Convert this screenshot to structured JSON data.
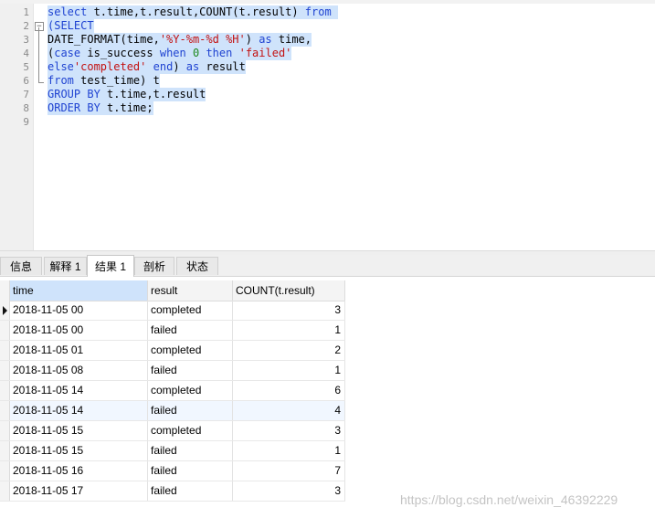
{
  "editor": {
    "line_numbers": [
      "1",
      "2",
      "3",
      "4",
      "5",
      "6",
      "7",
      "8",
      "9"
    ],
    "lines": [
      [
        {
          "t": "select",
          "c": "kw"
        },
        {
          "t": " t.time,t.result,COUNT(t.result) ",
          "c": ""
        },
        {
          "t": "from",
          "c": "kw"
        },
        {
          "t": " ",
          "c": ""
        }
      ],
      [
        {
          "t": "(SELECT",
          "c": "kw"
        }
      ],
      [
        {
          "t": "DATE_FORMAT(time,",
          "c": ""
        },
        {
          "t": "'%Y-%m-%d %H'",
          "c": "str"
        },
        {
          "t": ") ",
          "c": ""
        },
        {
          "t": "as",
          "c": "kw"
        },
        {
          "t": " time,",
          "c": ""
        }
      ],
      [
        {
          "t": "(",
          "c": ""
        },
        {
          "t": "case",
          "c": "kw"
        },
        {
          "t": " is_success ",
          "c": ""
        },
        {
          "t": "when",
          "c": "kw"
        },
        {
          "t": " ",
          "c": ""
        },
        {
          "t": "0",
          "c": "num"
        },
        {
          "t": " ",
          "c": ""
        },
        {
          "t": "then",
          "c": "kw"
        },
        {
          "t": " ",
          "c": ""
        },
        {
          "t": "'failed'",
          "c": "str"
        }
      ],
      [
        {
          "t": "else",
          "c": "kw"
        },
        {
          "t": "'completed'",
          "c": "str"
        },
        {
          "t": " ",
          "c": ""
        },
        {
          "t": "end",
          "c": "kw"
        },
        {
          "t": ") ",
          "c": ""
        },
        {
          "t": "as",
          "c": "kw"
        },
        {
          "t": " result",
          "c": ""
        }
      ],
      [
        {
          "t": "from",
          "c": "kw"
        },
        {
          "t": " test_time) t",
          "c": ""
        }
      ],
      [
        {
          "t": "GROUP BY",
          "c": "kw"
        },
        {
          "t": " t.time,t.result",
          "c": ""
        }
      ],
      [
        {
          "t": "ORDER BY",
          "c": "kw"
        },
        {
          "t": " t.time;",
          "c": ""
        }
      ],
      []
    ]
  },
  "tabs": [
    {
      "label": "信息",
      "active": false
    },
    {
      "label": "解释 1",
      "active": false
    },
    {
      "label": "结果 1",
      "active": true
    },
    {
      "label": "剖析",
      "active": false
    },
    {
      "label": "状态",
      "active": false
    }
  ],
  "grid": {
    "columns": [
      "time",
      "result",
      "COUNT(t.result)"
    ],
    "rows": [
      [
        "2018-11-05 00",
        "completed",
        "3"
      ],
      [
        "2018-11-05 00",
        "failed",
        "1"
      ],
      [
        "2018-11-05 01",
        "completed",
        "2"
      ],
      [
        "2018-11-05 08",
        "failed",
        "1"
      ],
      [
        "2018-11-05 14",
        "completed",
        "6"
      ],
      [
        "2018-11-05 14",
        "failed",
        "4"
      ],
      [
        "2018-11-05 15",
        "completed",
        "3"
      ],
      [
        "2018-11-05 15",
        "failed",
        "1"
      ],
      [
        "2018-11-05 16",
        "failed",
        "7"
      ],
      [
        "2018-11-05 17",
        "failed",
        "3"
      ]
    ],
    "current_row_index": 0,
    "highlighted_row_index": 5
  },
  "watermark": "https://blog.csdn.net/weixin_46392229",
  "colors": {
    "keyword": "#1f43d1",
    "string": "#c31212",
    "number": "#1f8a1f",
    "selection": "#cfe3fb"
  }
}
